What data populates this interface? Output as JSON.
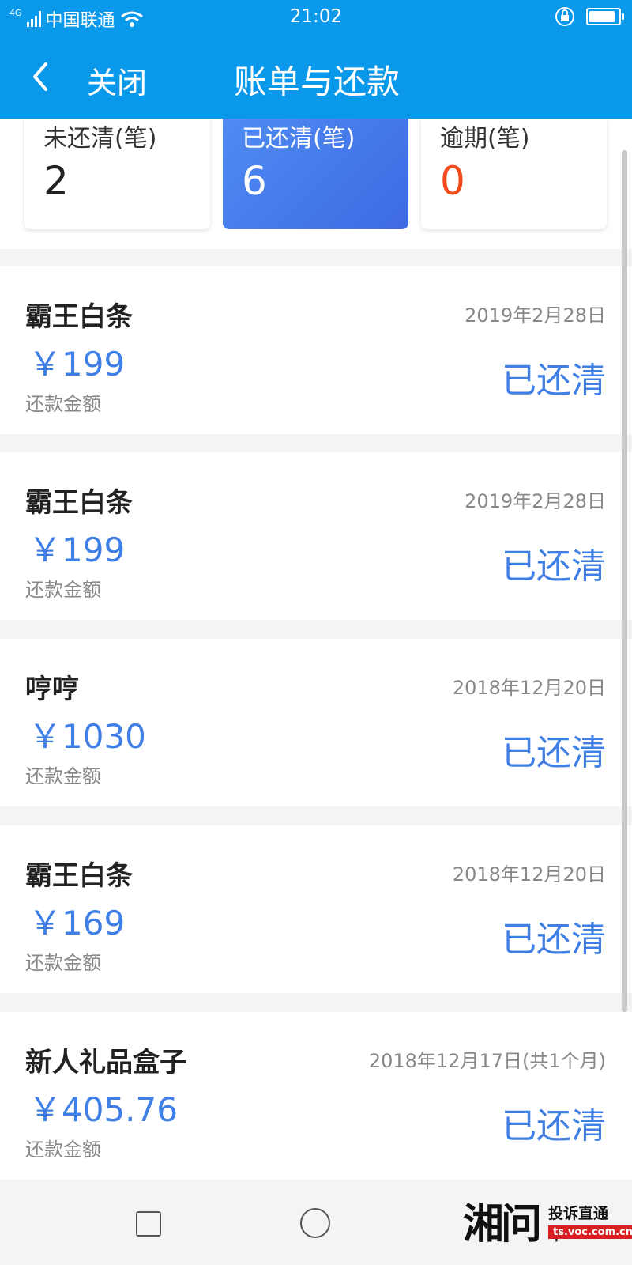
{
  "status_bar": {
    "network": "4G",
    "carrier": "中国联通",
    "time": "21:02",
    "battery_level": 0.95
  },
  "header": {
    "close_label": "关闭",
    "title": "账单与还款",
    "background_color": "#0a98ea"
  },
  "summary": {
    "cards": [
      {
        "label": "未还清(笔)",
        "value": "2"
      },
      {
        "label": "已还清(笔)",
        "value": "6"
      },
      {
        "label": "逾期(笔)",
        "value": "0"
      }
    ],
    "active_color": "#4e8cf3",
    "overdue_color": "#f24a1a"
  },
  "bills": [
    {
      "name": "霸王白条",
      "date": "2019年2月28日",
      "amount": "￥199",
      "amount_label": "还款金额",
      "status": "已还清"
    },
    {
      "name": "霸王白条",
      "date": "2019年2月28日",
      "amount": "￥199",
      "amount_label": "还款金额",
      "status": "已还清"
    },
    {
      "name": "哼哼",
      "date": "2018年12月20日",
      "amount": "￥1030",
      "amount_label": "还款金额",
      "status": "已还清"
    },
    {
      "name": "霸王白条",
      "date": "2018年12月20日",
      "amount": "￥169",
      "amount_label": "还款金额",
      "status": "已还清"
    },
    {
      "name": "新人礼品盒子",
      "date": "2018年12月17日(共1个月)",
      "amount": "￥405.76",
      "amount_label": "还款金额",
      "status": "已还清"
    }
  ],
  "accent_color": "#3f7fe6",
  "watermark": {
    "logo": "湘问",
    "title": "投诉直通车",
    "url": "ts.voc.com.cn"
  }
}
